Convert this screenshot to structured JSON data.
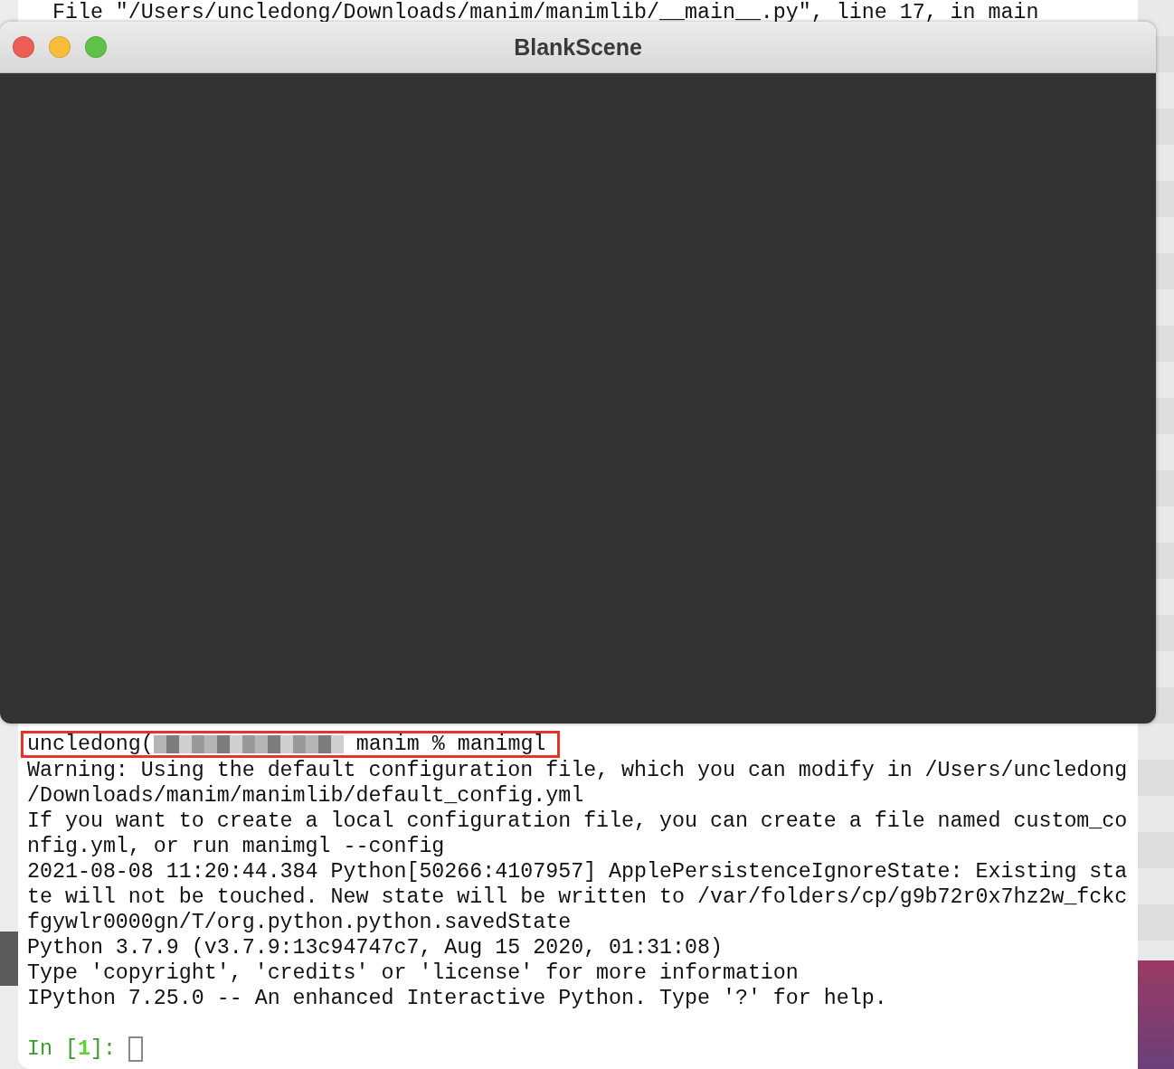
{
  "terminal": {
    "top_line": "  File \"/Users/uncledong/Downloads/manim/manimlib/__main__.py\", line 17, in main",
    "prompt": {
      "user": "uncledong(",
      "command": "manim % manimgl",
      "highlighted": true
    },
    "output": [
      "Warning: Using the default configuration file, which you can modify in /Users/uncledong",
      "/Downloads/manim/manimlib/default_config.yml",
      "If you want to create a local configuration file, you can create a file named custom_co",
      "nfig.yml, or run manimgl --config",
      "2021-08-08 11:20:44.384 Python[50266:4107957] ApplePersistenceIgnoreState: Existing sta",
      "te will not be touched. New state will be written to /var/folders/cp/g9b72r0x7hz2w_fckc",
      "fgywlr0000gn/T/org.python.python.savedState",
      "Python 3.7.9 (v3.7.9:13c94747c7, Aug 15 2020, 01:31:08)",
      "Type 'copyright', 'credits' or 'license' for more information",
      "IPython 7.25.0 -- An enhanced Interactive Python. Type '?' for help."
    ],
    "input_prompt": {
      "open": "In [",
      "number": "1",
      "close": "]:"
    }
  },
  "scene_window": {
    "title": "BlankScene",
    "buttons": [
      {
        "kind": "close"
      },
      {
        "kind": "minimize"
      },
      {
        "kind": "zoom"
      }
    ]
  }
}
